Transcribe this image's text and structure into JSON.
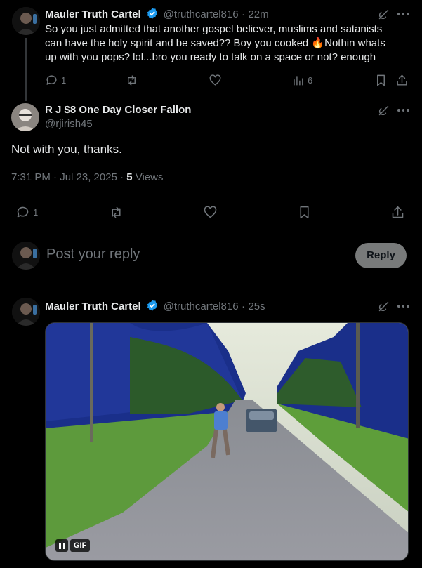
{
  "tweet_top": {
    "name": "Mauler Truth Cartel",
    "handle": "@truthcartel816",
    "sep": "·",
    "time": "22m",
    "line1": "So you just admitted that another gospel believer, muslims and satanists",
    "line2_a": "can have the holy spirit and be saved?? Boy you cooked ",
    "emoji": "🔥",
    "line2_b": "Nothin whats",
    "line3": "up with you pops? lol...bro you ready to talk on a space or not? enough",
    "reply_count": "1",
    "views_count": "6"
  },
  "main_tweet": {
    "name": "R J $8 One Day Closer Fallon",
    "handle": "@rjirish45",
    "text": "Not with you, thanks.",
    "timestamp": "7:31 PM · Jul 23, 2025 · ",
    "views_number": "5",
    "views_label": " Views",
    "reply_count": "1"
  },
  "reply_box": {
    "placeholder": "Post your reply",
    "button": "Reply"
  },
  "tweet_bottom": {
    "name": "Mauler Truth Cartel",
    "handle": "@truthcartel816",
    "sep": "·",
    "time": "25s",
    "gif_badge": "GIF"
  },
  "colors": {
    "background": "#000000",
    "verified": "#1d9bf0",
    "muted": "#71767b",
    "reply_button_bg": "#787a7a"
  }
}
